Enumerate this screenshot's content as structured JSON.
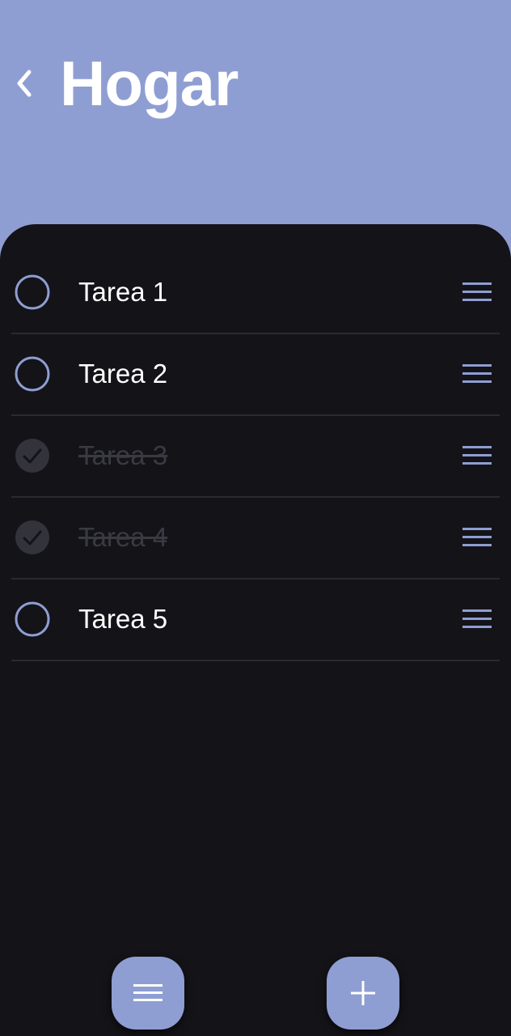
{
  "header": {
    "title": "Hogar",
    "back_icon": "chevron-left-icon"
  },
  "tasks": [
    {
      "label": "Tarea 1",
      "done": false
    },
    {
      "label": "Tarea 2",
      "done": false
    },
    {
      "label": "Tarea 3",
      "done": true
    },
    {
      "label": "Tarea 4",
      "done": true
    },
    {
      "label": "Tarea 5",
      "done": false
    }
  ],
  "bottom_actions": {
    "menu_icon": "menu-icon",
    "add_icon": "plus-icon"
  },
  "colors": {
    "accent": "#8f9ed2",
    "background": "#141318",
    "text": "#ffffff",
    "done_text": "#3a3a43"
  }
}
